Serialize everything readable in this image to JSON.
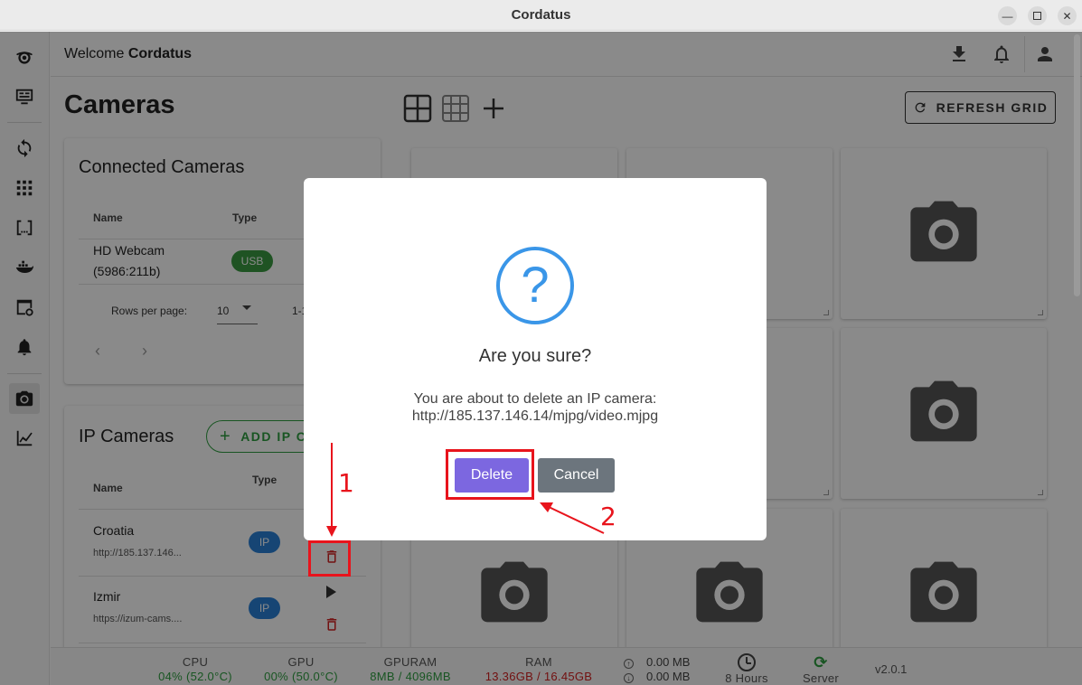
{
  "window": {
    "title": "Cordatus"
  },
  "header": {
    "welcome_prefix": "Welcome",
    "welcome_name": "Cordatus"
  },
  "page": {
    "title": "Cameras",
    "refresh_label": "REFRESH GRID"
  },
  "connected_cameras": {
    "title": "Connected Cameras",
    "columns": [
      "Name",
      "Type"
    ],
    "rows": [
      {
        "name_line1": "HD Webcam",
        "name_line2": "(5986:211b)",
        "type": "USB"
      }
    ],
    "rows_per_page_label": "Rows per page:",
    "rows_per_page_value": "10",
    "range_text": "1-1"
  },
  "ip_cameras": {
    "title": "IP Cameras",
    "add_label": "ADD IP CA",
    "columns": [
      "Name",
      "Type"
    ],
    "rows": [
      {
        "name": "Croatia",
        "url": "http://185.137.146...",
        "type": "IP"
      },
      {
        "name": "Izmir",
        "url": "https://izum-cams....",
        "type": "IP"
      }
    ]
  },
  "dialog": {
    "icon": "question-mark",
    "title": "Are you sure?",
    "message_line1": "You are about to delete an IP camera:",
    "message_line2": "http://185.137.146.14/mjpg/video.mjpg",
    "delete_label": "Delete",
    "cancel_label": "Cancel"
  },
  "annotations": {
    "step1": "1",
    "step2": "2",
    "color": "#e8141c"
  },
  "status": {
    "cpu": {
      "label": "CPU",
      "value": "04% (52.0°C)"
    },
    "gpu": {
      "label": "GPU",
      "value": "00% (50.0°C)"
    },
    "gpuram": {
      "label": "GPURAM",
      "value": "8MB / 4096MB"
    },
    "ram": {
      "label": "RAM",
      "value": "13.36GB / 16.45GB"
    },
    "upload": "0.00 MB",
    "download": "0.00 MB",
    "uptime": "8 Hours",
    "server": "Server",
    "version": "v2.0.1"
  },
  "colors": {
    "green": "#2e9e3f",
    "red": "#d32020",
    "usb_chip": "#3a9a42",
    "ip_chip": "#2a80d6",
    "delete_btn": "#7c67e0",
    "cancel_btn": "#6c757d"
  }
}
